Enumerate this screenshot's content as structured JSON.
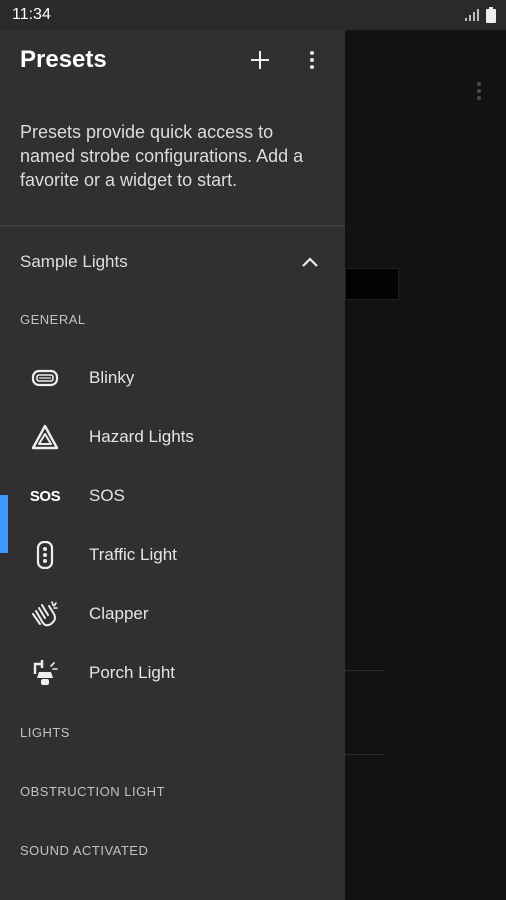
{
  "status_bar": {
    "time": "11:34"
  },
  "drawer": {
    "title": "Presets",
    "intro_text": "Presets provide quick access to named strobe configurations. Add a favorite or a widget to start.",
    "section": {
      "label": "Sample Lights",
      "expanded": true
    },
    "categories": {
      "general": "GENERAL",
      "lights": "LIGHTS",
      "obstruction": "OBSTRUCTION LIGHT",
      "sound": "SOUND ACTIVATED"
    },
    "items": [
      {
        "label": "Blinky",
        "icon": "blinky-icon"
      },
      {
        "label": "Hazard Lights",
        "icon": "hazard-triangle-icon"
      },
      {
        "label": "SOS",
        "icon": "sos-icon",
        "icon_text": "SOS",
        "selected": true
      },
      {
        "label": "Traffic Light",
        "icon": "traffic-light-icon"
      },
      {
        "label": "Clapper",
        "icon": "clapping-hands-icon"
      },
      {
        "label": "Porch Light",
        "icon": "porch-lamp-icon"
      }
    ]
  },
  "colors": {
    "drawer_bg": "#303030",
    "selection_accent": "#3d98ff",
    "status_bar_bg": "#2a2a2a"
  }
}
